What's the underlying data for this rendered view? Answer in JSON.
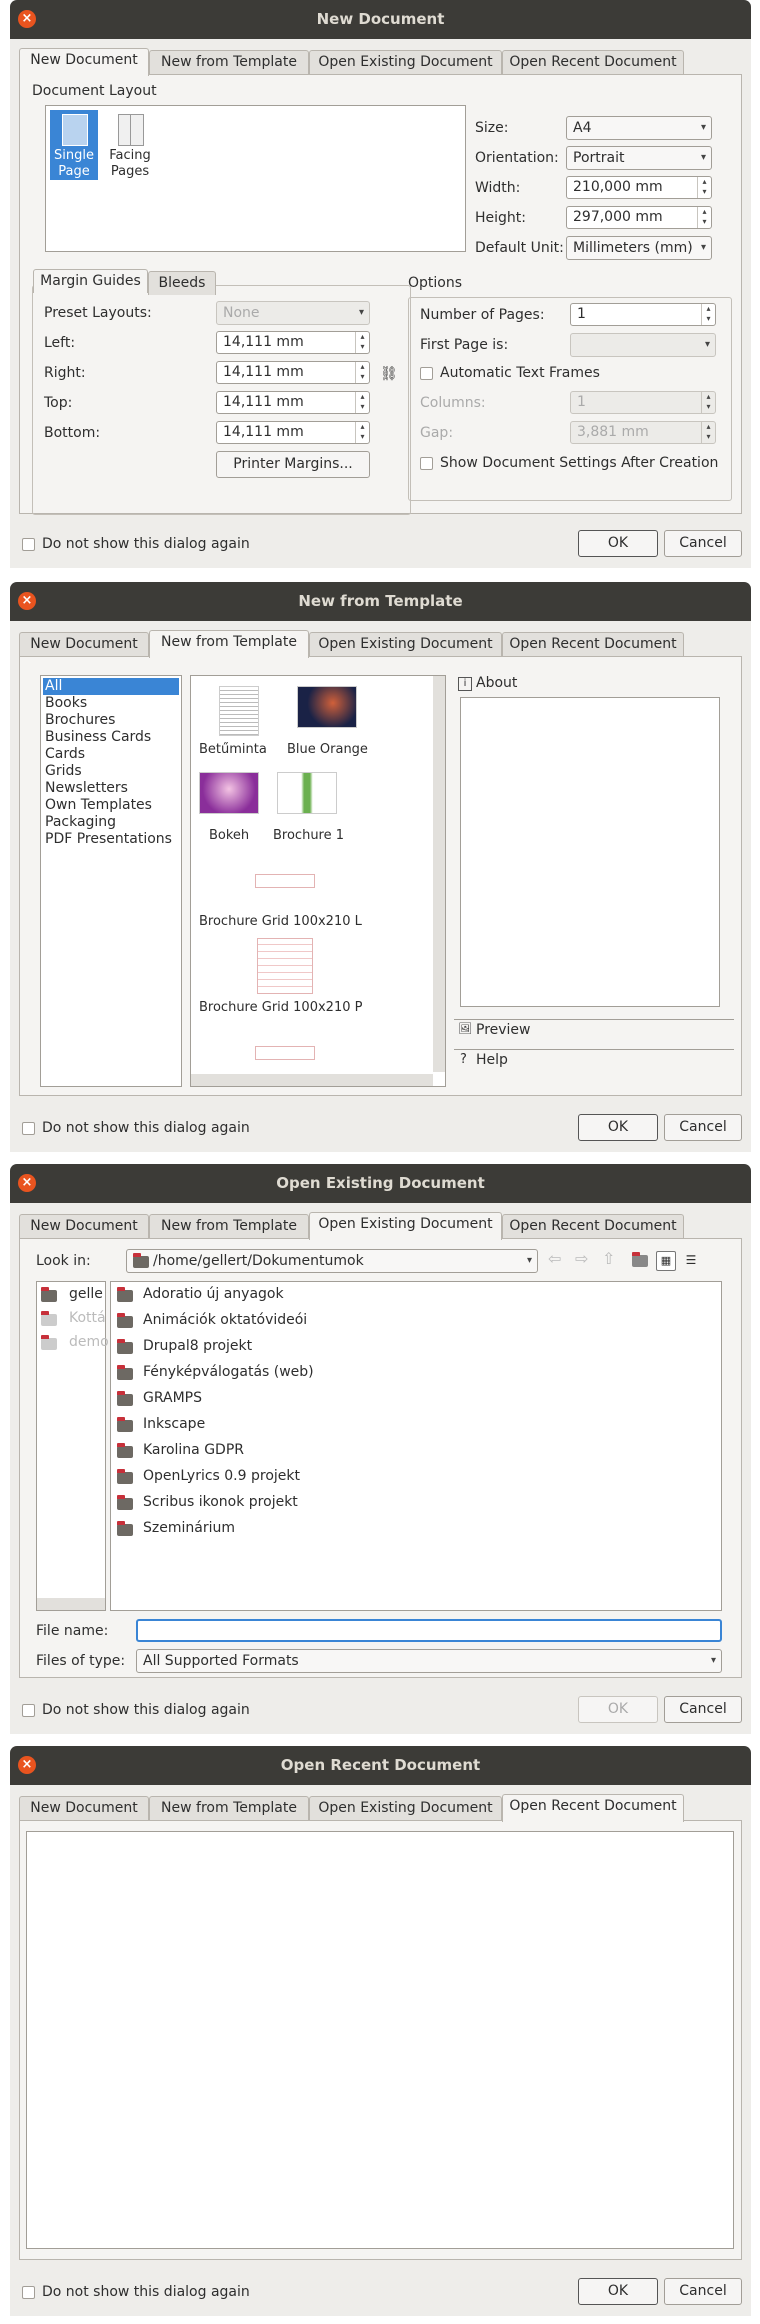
{
  "tabs": [
    "New Document",
    "New from Template",
    "Open Existing Document",
    "Open Recent Document"
  ],
  "footer": {
    "dont_show": "Do not show this dialog again",
    "ok": "OK",
    "cancel": "Cancel"
  },
  "icons": {
    "close": "×",
    "dropdown": "▾",
    "spin_up": "▴",
    "spin_down": "▾",
    "info": "i",
    "preview": "🖼",
    "help": "?",
    "chain": "⛓"
  },
  "dialog1": {
    "title": "New Document",
    "layout_title": "Document Layout",
    "single_page": [
      "Single",
      "Page"
    ],
    "facing_pages": [
      "Facing",
      "Pages"
    ],
    "size_label": "Size:",
    "size_value": "A4",
    "orientation_label": "Orientation:",
    "orientation_value": "Portrait",
    "width_label": "Width:",
    "width_value": "210,000 mm",
    "height_label": "Height:",
    "height_value": "297,000 mm",
    "unit_label": "Default Unit:",
    "unit_value": "Millimeters (mm)",
    "margin_tab": "Margin Guides",
    "bleeds_tab": "Bleeds",
    "preset_label": "Preset Layouts:",
    "preset_value": "None",
    "left_label": "Left:",
    "left_value": "14,111 mm",
    "right_label": "Right:",
    "right_value": "14,111 mm",
    "top_label": "Top:",
    "top_value": "14,111 mm",
    "bottom_label": "Bottom:",
    "bottom_value": "14,111 mm",
    "printer_margins": "Printer Margins...",
    "options_title": "Options",
    "num_pages_label": "Number of Pages:",
    "num_pages_value": "1",
    "first_page_label": "First Page is:",
    "auto_frames": "Automatic Text Frames",
    "columns_label": "Columns:",
    "columns_value": "1",
    "gap_label": "Gap:",
    "gap_value": "3,881 mm",
    "show_settings": "Show Document Settings After Creation"
  },
  "dialog2": {
    "title": "New from Template",
    "categories": [
      "All",
      "Books",
      "Brochures",
      "Business Cards",
      "Cards",
      "Grids",
      "Newsletters",
      "Own Templates",
      "Packaging",
      "PDF Presentations"
    ],
    "templates": [
      "Betűminta",
      "Blue Orange",
      "Bokeh",
      "Brochure 1",
      "Brochure Grid 100x210 L",
      "Brochure Grid 100x210 P"
    ],
    "about": "About",
    "preview": "Preview",
    "help": "Help"
  },
  "dialog3": {
    "title": "Open Existing Document",
    "look_in_label": "Look in:",
    "look_in_value": "/home/gellert/Dokumentumok",
    "sidebar": [
      "gelle",
      "Kottá",
      "demo"
    ],
    "folders": [
      "Adoratio új anyagok",
      "Animációk oktatóvideói",
      "Drupal8 projekt",
      "Fényképválogatás (web)",
      "GRAMPS",
      "Inkscape",
      "Karolina GDPR",
      "OpenLyrics 0.9 projekt",
      "Scribus ikonok projekt",
      "Szeminárium"
    ],
    "file_name_label": "File name:",
    "file_name_value": "",
    "files_type_label": "Files of type:",
    "files_type_value": "All Supported Formats",
    "nav_icons": [
      "back-icon",
      "forward-icon",
      "parent-dir-icon",
      "new-folder-icon",
      "list-view-icon",
      "detail-view-icon"
    ]
  },
  "dialog4": {
    "title": "Open Recent Document"
  }
}
